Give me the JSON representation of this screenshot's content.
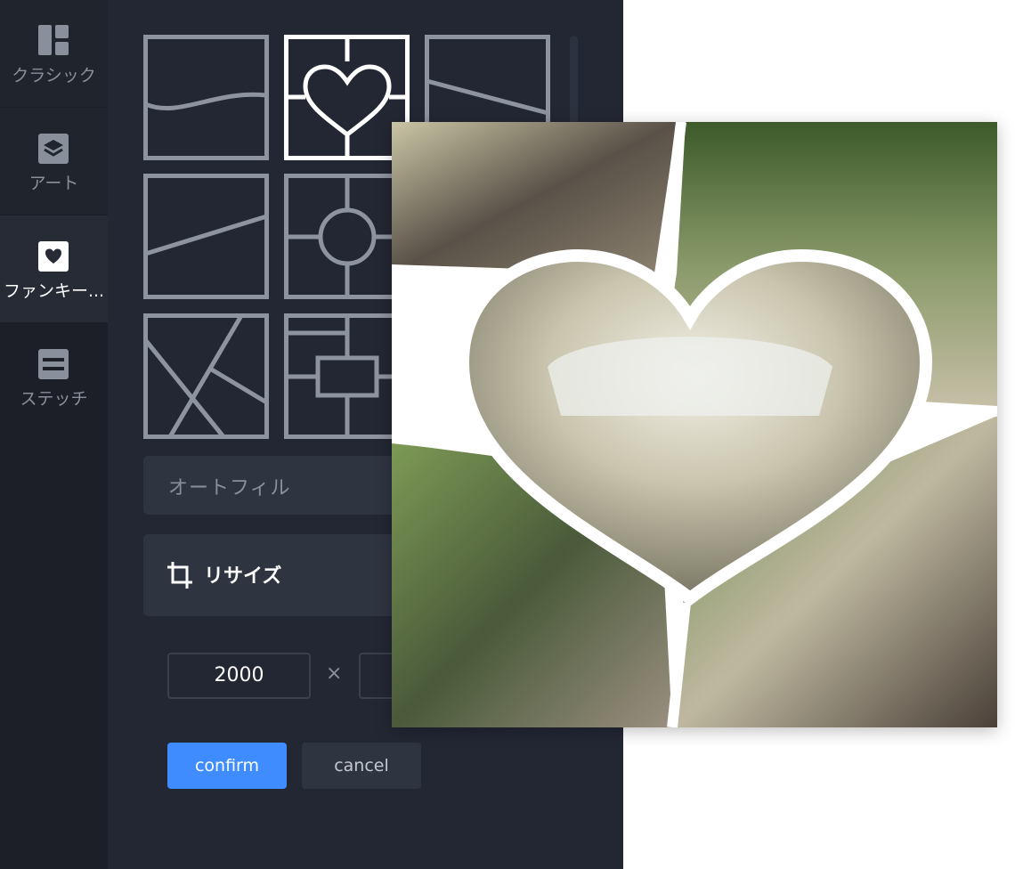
{
  "rail": {
    "items": [
      {
        "label": "クラシック",
        "icon": "classic-layout-icon"
      },
      {
        "label": "アート",
        "icon": "layers-icon"
      },
      {
        "label": "ファンキー...",
        "icon": "heart-icon"
      },
      {
        "label": "ステッチ",
        "icon": "stitch-icon"
      }
    ],
    "active_index": 2
  },
  "panel": {
    "autofill_label": "オートフィル",
    "resize_label": "リサイズ",
    "width_value": "2000",
    "times_symbol": "×",
    "confirm_label": "confirm",
    "cancel_label": "cancel",
    "selected_template_index": 1
  },
  "colors": {
    "accent": "#3e8cff",
    "rail_bg": "#1c1f28",
    "panel_bg": "#232733",
    "control_bg": "#2f3441"
  }
}
